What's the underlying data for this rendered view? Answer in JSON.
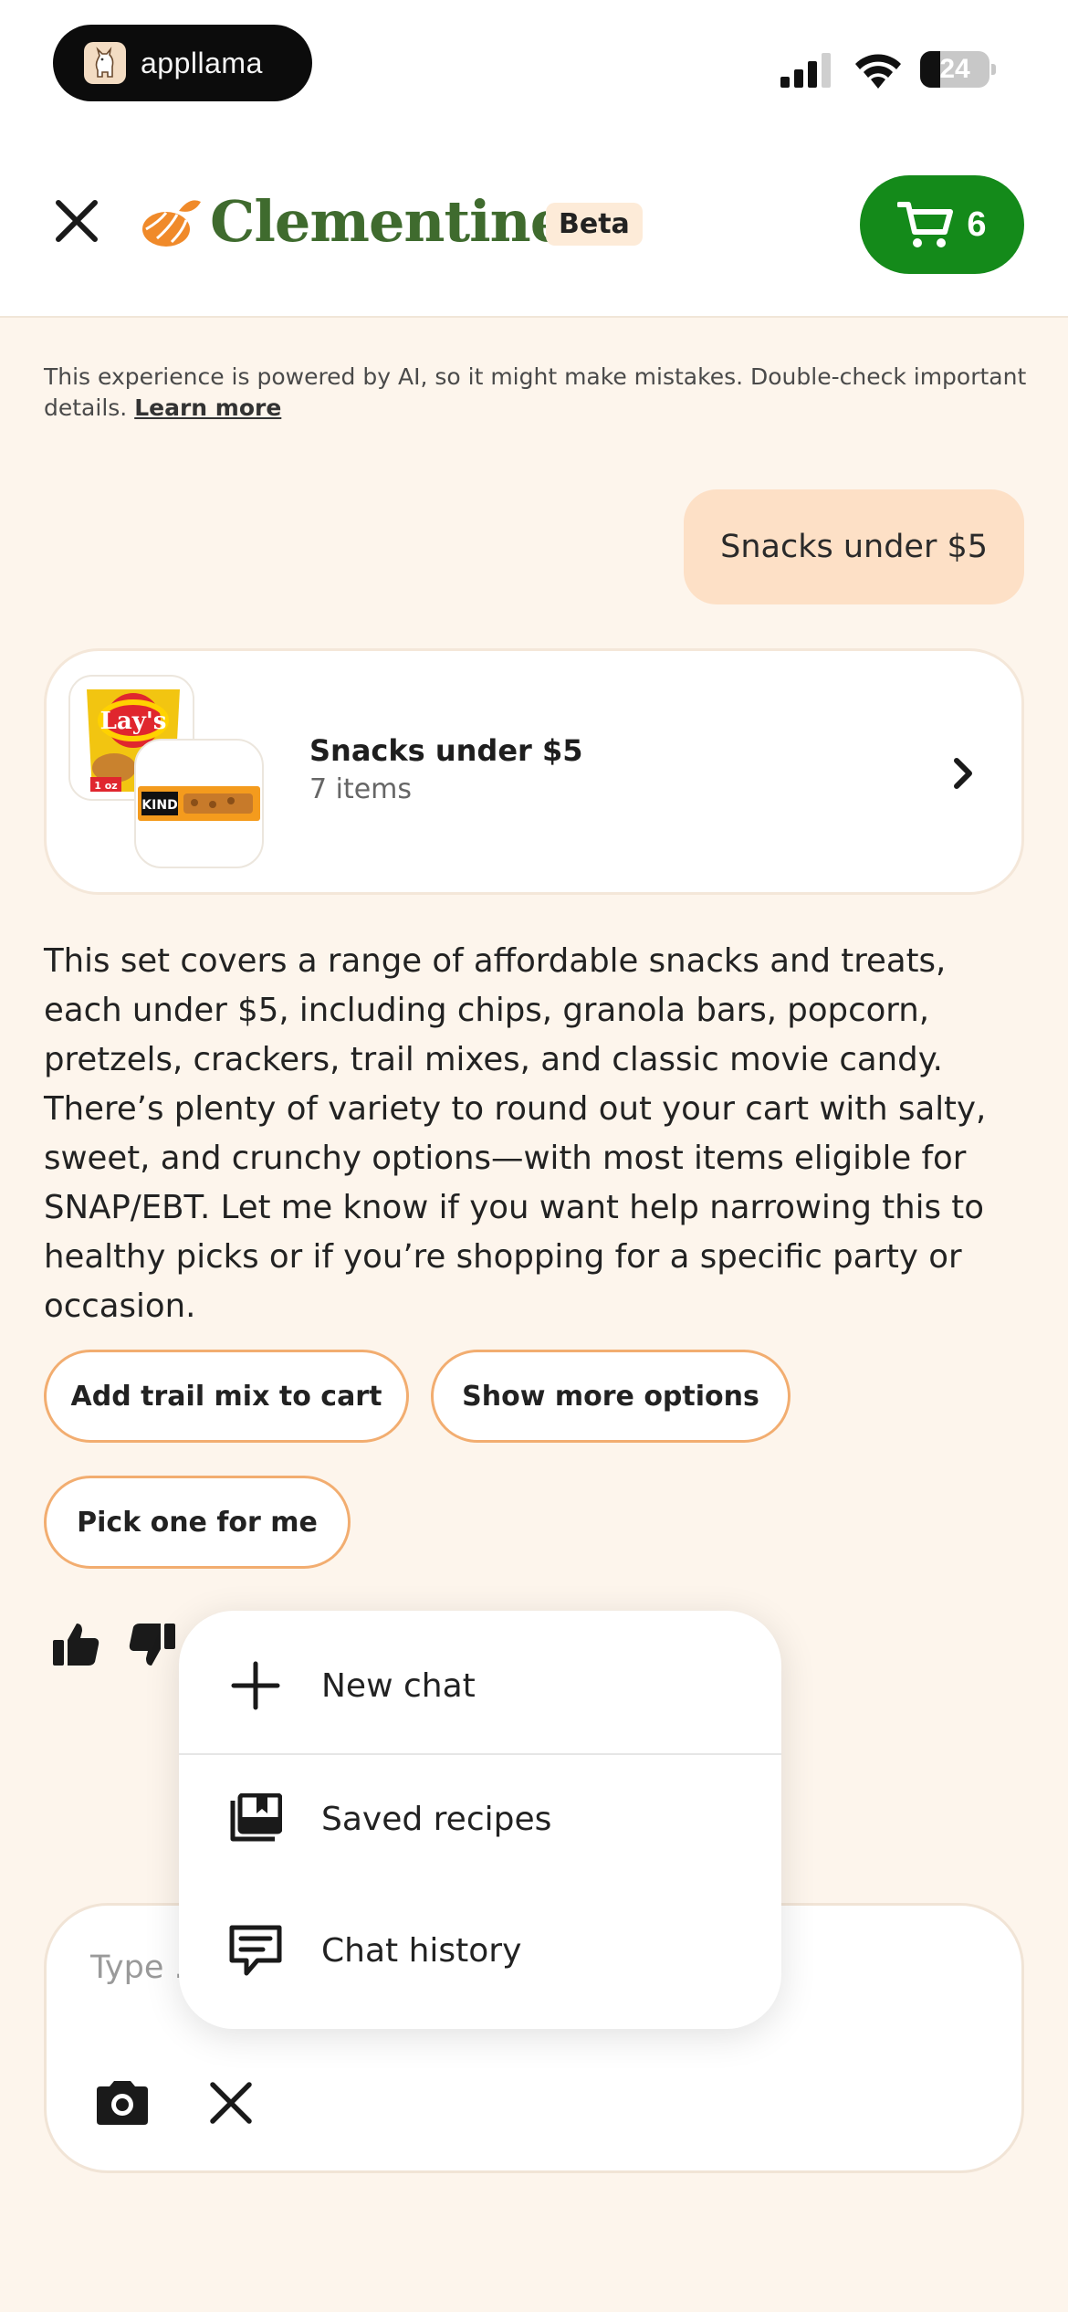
{
  "status_bar": {
    "app_badge": "appllama",
    "battery": "24"
  },
  "header": {
    "brand": "Clementine",
    "beta_label": "Beta",
    "cart_count": "6"
  },
  "disclaimer": {
    "text": "This experience is powered by AI, so it might make mistakes. Double-check important details. ",
    "link": "Learn more"
  },
  "user_message": "Snacks under $5",
  "result_card": {
    "title": "Snacks under $5",
    "subtitle": "7 items",
    "thumb1_label": "Lay's",
    "thumb1_sublabel": "1 oz",
    "thumb2_label": "KIND"
  },
  "assistant_message": "This set covers a range of affordable snacks and treats, each under $5, including chips, granola bars, popcorn, pretzels, crackers, trail mixes, and classic movie candy. There’s plenty of variety to round out your cart with salty, sweet, and crunchy options—with most items eligible for SNAP/EBT. Let me know if you want help narrowing this to healthy picks or if you’re shopping for a specific party or occasion.",
  "suggestions": [
    "Add trail mix to cart",
    "Show more options",
    "Pick one for me"
  ],
  "composer": {
    "placeholder": "Type ..."
  },
  "menu": {
    "items": [
      {
        "label": "New chat",
        "icon": "plus-icon"
      },
      {
        "label": "Saved recipes",
        "icon": "saved-recipes-icon"
      },
      {
        "label": "Chat history",
        "icon": "chat-history-icon"
      }
    ]
  },
  "colors": {
    "brand_green": "#3f6b2e",
    "cart_green": "#148a1a",
    "accent_orange": "#f08a2a",
    "chip_border": "#f2ad70",
    "background": "#fdf5ec"
  }
}
